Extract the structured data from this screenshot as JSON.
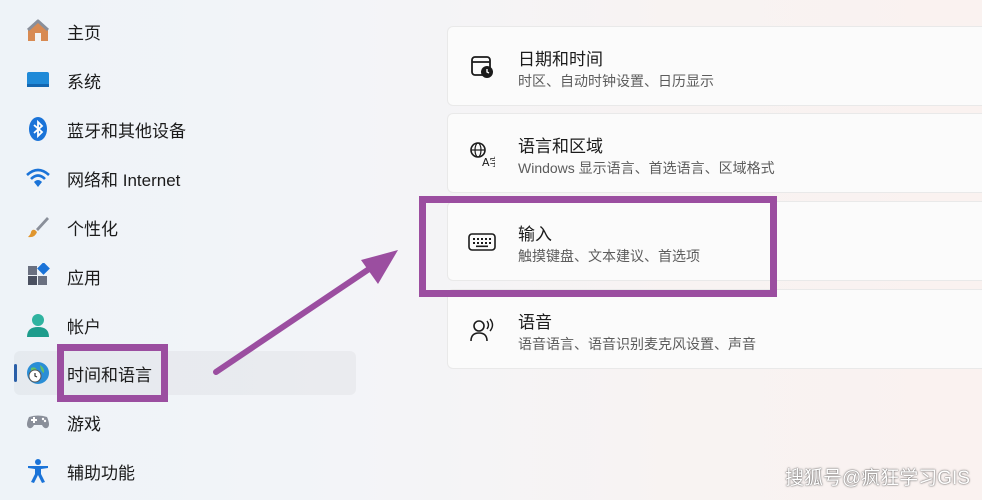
{
  "sidebar": {
    "items": [
      {
        "label": "主页",
        "icon": "home-icon"
      },
      {
        "label": "系统",
        "icon": "system-display-icon"
      },
      {
        "label": "蓝牙和其他设备",
        "icon": "bluetooth-icon"
      },
      {
        "label": "网络和 Internet",
        "icon": "wifi-icon"
      },
      {
        "label": "个性化",
        "icon": "paintbrush-icon"
      },
      {
        "label": "应用",
        "icon": "apps-icon"
      },
      {
        "label": "帐户",
        "icon": "account-icon"
      },
      {
        "label": "时间和语言",
        "icon": "globe-clock-icon",
        "active": true
      },
      {
        "label": "游戏",
        "icon": "gamepad-icon"
      },
      {
        "label": "辅助功能",
        "icon": "accessibility-icon"
      }
    ]
  },
  "cards": [
    {
      "title": "日期和时间",
      "desc": "时区、自动时钟设置、日历显示",
      "icon": "calendar-clock-icon"
    },
    {
      "title": "语言和区域",
      "desc": "Windows 显示语言、首选语言、区域格式",
      "icon": "language-icon"
    },
    {
      "title": "输入",
      "desc": "触摸键盘、文本建议、首选项",
      "icon": "keyboard-icon"
    },
    {
      "title": "语音",
      "desc": "语音语言、语音识别麦克风设置、声音",
      "icon": "speech-icon"
    }
  ],
  "annotation": {
    "color": "#9b4ea0"
  },
  "accent_color": "#2a5fa8",
  "watermark": "搜狐号@疯狂学习GIS"
}
